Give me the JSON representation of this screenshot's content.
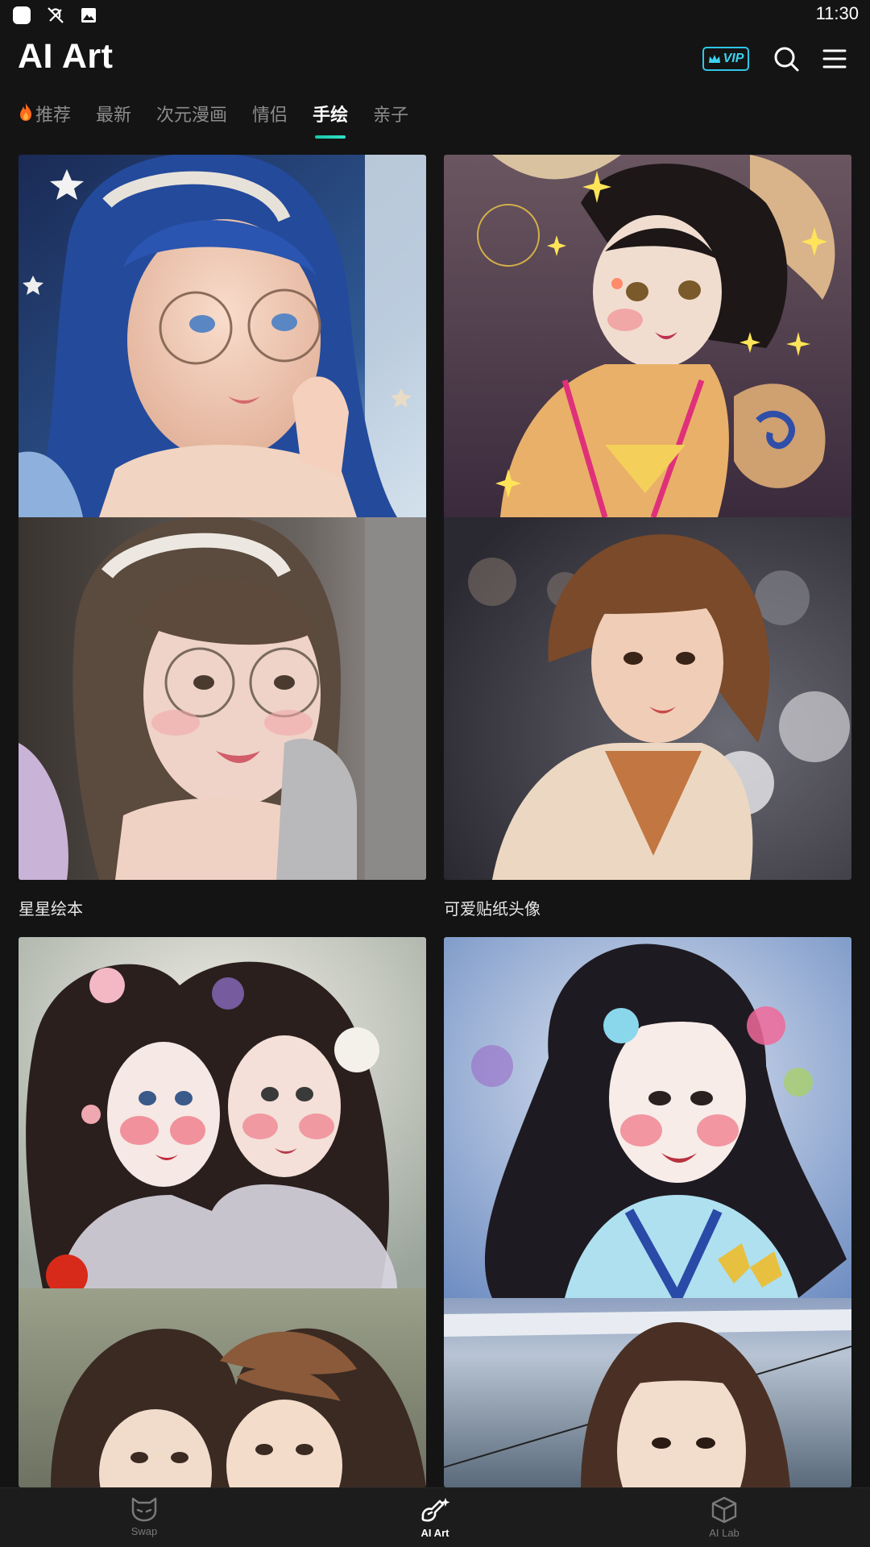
{
  "status_bar": {
    "time": "11:30"
  },
  "header": {
    "title": "AI Art",
    "vip_label": "VIP"
  },
  "tabs": [
    {
      "label": "推荐",
      "icon": "fire-icon"
    },
    {
      "label": "最新"
    },
    {
      "label": "次元漫画"
    },
    {
      "label": "情侣"
    },
    {
      "label": "手绘",
      "active": true
    },
    {
      "label": "亲子"
    }
  ],
  "cards": [
    {
      "label": "星星绘本"
    },
    {
      "label": "可爱贴纸头像"
    },
    {
      "label": ""
    },
    {
      "label": ""
    }
  ],
  "bottom_nav": {
    "items": [
      {
        "label": "Swap",
        "icon": "mask-icon"
      },
      {
        "label": "AI Art",
        "icon": "brush-sparkle-icon",
        "active": true
      },
      {
        "label": "AI Lab",
        "icon": "cube-icon"
      }
    ]
  },
  "colors": {
    "accent": "#20d0b4",
    "vip": "#2fc7e6",
    "background": "#141414"
  }
}
